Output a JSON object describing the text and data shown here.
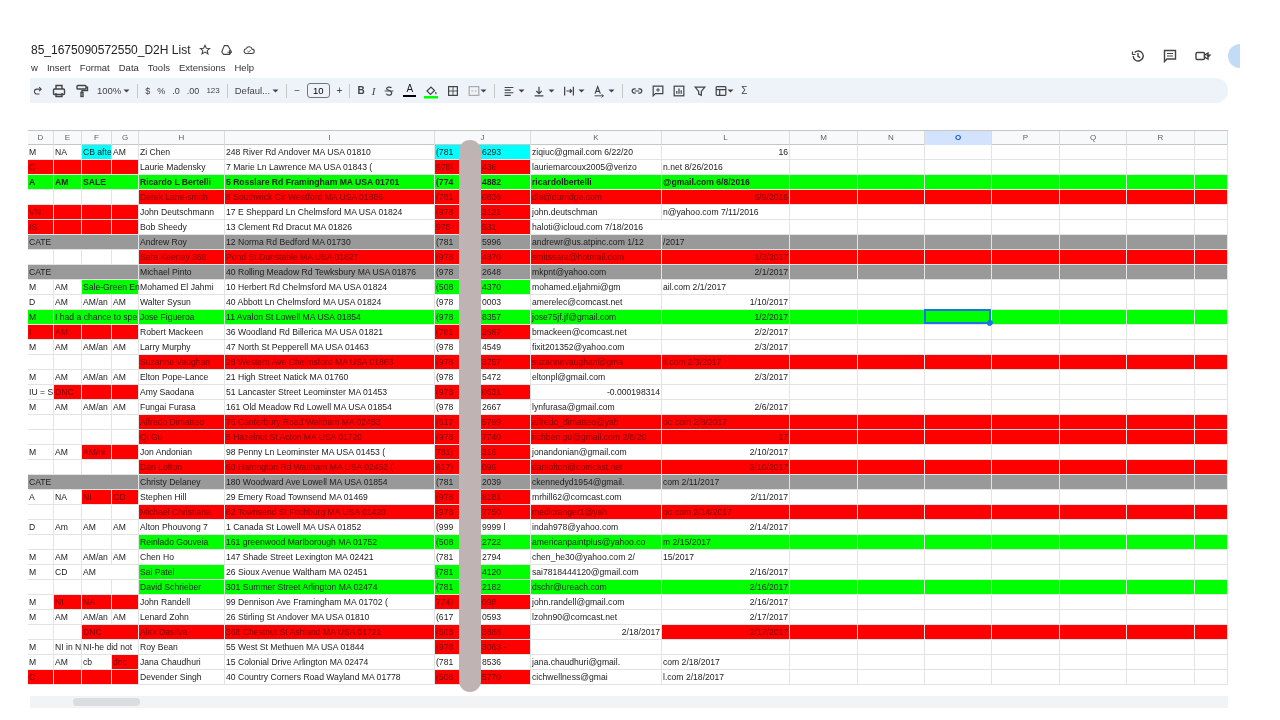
{
  "title": {
    "name": "85_1675090572550_D2H List"
  },
  "menu": [
    "w",
    "Insert",
    "Format",
    "Data",
    "Tools",
    "Extensions",
    "Help"
  ],
  "toolbar": {
    "zoom": "100%",
    "currency": "$",
    "percent": "%",
    "decrease_decimals": ".0",
    "increase_decimals": ".00",
    "number_format": "123",
    "font": "Defaul...",
    "minus": "−",
    "font_size": "10",
    "plus": "+",
    "bold": "B",
    "italic": "I",
    "text_color": "A",
    "functions": "Σ"
  },
  "sheet": {
    "columns": [
      {
        "label": "D",
        "selected": false
      },
      {
        "label": "E",
        "selected": false
      },
      {
        "label": "F",
        "selected": false
      },
      {
        "label": "G",
        "selected": false
      },
      {
        "label": "H",
        "selected": false
      },
      {
        "label": "I",
        "selected": false
      },
      {
        "label": "J",
        "selected": false
      },
      {
        "label": "K",
        "selected": false
      },
      {
        "label": "L",
        "selected": false
      },
      {
        "label": "M",
        "selected": false
      },
      {
        "label": "N",
        "selected": false
      },
      {
        "label": "O",
        "selected": true
      },
      {
        "label": "P",
        "selected": false
      },
      {
        "label": "Q",
        "selected": false
      },
      {
        "label": "R",
        "selected": false
      }
    ],
    "rows": [
      {
        "bold": false,
        "selected": false,
        "cells": [
          {
            "text": "M"
          },
          {
            "text": "NA"
          },
          {
            "text": "CB afte",
            "color": "#00ffff"
          },
          {
            "text": "AM"
          },
          {
            "text": "Zi Chen"
          },
          {
            "text": "248 River Rd Andover MA USA 01810"
          },
          {
            "parts": [
              "(781",
              "6293"
            ],
            "color": "#00ffff"
          },
          {
            "text": "ziqiuc@gmail.com 6/22/20"
          },
          {
            "text": "16",
            "kind": "number"
          }
        ]
      },
      {
        "bold": false,
        "selected": false,
        "cells": [
          {
            "text": "C",
            "color": "#ff0000"
          },
          {
            "color": "#ff0000"
          },
          {
            "color": "#ff0000"
          },
          {
            "color": "#ff0000"
          },
          {
            "text": "Laurie Madensky"
          },
          {
            "text": "7 Marie Ln Lawrence MA USA 01843 ("
          },
          {
            "parts": [
              "978)",
              "436"
            ],
            "color": "#ff0000"
          },
          {
            "text": "lauriemarcoux2005@verizo"
          },
          {
            "text": "n.net 8/26/2016"
          }
        ]
      },
      {
        "color": "#00ff00",
        "bold": true,
        "selected": false,
        "cells": [
          {
            "text": "A"
          },
          {
            "text": "AM"
          },
          {
            "text": "SALE"
          },
          {},
          {
            "text": "Ricardo L Bertelli"
          },
          {
            "text": "5 Rosslare Rd Framingham MA USA 01701"
          },
          {
            "parts": [
              "(774",
              "4882"
            ]
          },
          {
            "text": "ricardolbertelli"
          },
          {
            "text": "@gmail.com 6/8/2016"
          }
        ]
      },
      {
        "color": "#ff0000",
        "bold": false,
        "selected": false,
        "cells": [
          {
            "color": "#ffffff"
          },
          {
            "color": "#ffffff"
          },
          {
            "color": "#ffffff"
          },
          {
            "color": "#ffffff"
          },
          {
            "text": "Derek Lane-smith"
          },
          {
            "text": "8 Southwick Cir Westford MA USA 01886"
          },
          {
            "parts": [
              "(781",
              "0836"
            ]
          },
          {
            "text": "dls@durridge.com"
          },
          {
            "text": "6/9/2016",
            "kind": "number"
          }
        ]
      },
      {
        "bold": false,
        "selected": false,
        "cells": [
          {
            "text": "VN",
            "color": "#ff0000"
          },
          {
            "color": "#ff0000"
          },
          {
            "color": "#ff0000"
          },
          {
            "color": "#ff0000"
          },
          {
            "text": "John Deutschmann"
          },
          {
            "text": "17 E Sheppard Ln Chelmsford MA USA 01824"
          },
          {
            "parts": [
              "(978",
              "3121"
            ],
            "color": "#ff0000"
          },
          {
            "text": "john.deutschman"
          },
          {
            "text": "n@yahoo.com 7/11/2016"
          }
        ]
      },
      {
        "bold": false,
        "selected": false,
        "cells": [
          {
            "text": "IS",
            "color": "#ff0000"
          },
          {
            "color": "#ff0000"
          },
          {
            "color": "#ff0000"
          },
          {
            "color": "#ff0000"
          },
          {
            "text": "Bob Sheedy"
          },
          {
            "text": "13 Clement Rd Dracut MA 01826"
          },
          {
            "parts": [
              "978-",
              "531"
            ],
            "color": "#ff0000"
          },
          {
            "text": "haloti@icloud.com 7/18/2016"
          },
          {}
        ]
      },
      {
        "color": "#999999",
        "bold": false,
        "selected": false,
        "cells": [
          {
            "text": "CATE"
          },
          {},
          {},
          {},
          {
            "text": "Andrew Roy"
          },
          {
            "text": "12 Norma Rd Bedford MA 01730"
          },
          {
            "parts": [
              "(781",
              "5996"
            ]
          },
          {
            "text": "andrewr@us.atpinc.com 1/12"
          },
          {
            "text": "/2017"
          }
        ]
      },
      {
        "color": "#ff0000",
        "bold": false,
        "selected": false,
        "cells": [
          {
            "color": "#ffffff"
          },
          {
            "color": "#ffffff"
          },
          {
            "color": "#ffffff"
          },
          {
            "color": "#ffffff"
          },
          {
            "text": "Sara Keeney 368"
          },
          {
            "text": "Pond St Dunstable MA USA 01827"
          },
          {
            "parts": [
              "(978",
              "4870"
            ]
          },
          {
            "text": "smitssara@hotmail.com"
          },
          {
            "text": "1/3/2017",
            "kind": "number"
          }
        ]
      },
      {
        "color": "#999999",
        "bold": false,
        "selected": false,
        "cells": [
          {
            "text": "CATE"
          },
          {},
          {},
          {},
          {
            "text": "Michael Pinto"
          },
          {
            "text": "40 Rolling Meadow Rd Tewksbury MA USA 01876"
          },
          {
            "parts": [
              "(978",
              "2648"
            ]
          },
          {
            "text": "mkpnt@yahoo.com"
          },
          {
            "text": "2/1/2017",
            "kind": "number"
          }
        ]
      },
      {
        "bold": false,
        "selected": false,
        "cells": [
          {
            "text": "M"
          },
          {
            "text": "AM"
          },
          {
            "text": "Sale-Green En",
            "color": "#00ff00"
          },
          {},
          {
            "text": "Mohamed El Jahmi"
          },
          {
            "text": "10 Herbert Rd Chelmsford MA USA 01824"
          },
          {
            "parts": [
              "(508",
              "4370"
            ],
            "color": "#00ff00"
          },
          {
            "text": "mohamed.eljahmi@gm"
          },
          {
            "text": "ail.com 2/1/2017"
          }
        ]
      },
      {
        "bold": false,
        "selected": false,
        "cells": [
          {
            "text": "D"
          },
          {
            "text": "AM"
          },
          {
            "text": "AM/an"
          },
          {
            "text": "AM"
          },
          {
            "text": "Walter Sysun"
          },
          {
            "text": "40 Abbott Ln Chelmsford MA USA 01824"
          },
          {
            "parts": [
              "(978",
              "0003"
            ]
          },
          {
            "text": "amerelec@comcast.net"
          },
          {
            "text": "1/10/2017",
            "kind": "number"
          }
        ]
      },
      {
        "color": "#00ff00",
        "bold": false,
        "selected": true,
        "cells": [
          {
            "text": "M"
          },
          {
            "text": "I had a chance to spe"
          },
          {},
          {},
          {
            "text": "Jose Figueroa"
          },
          {
            "text": "11 Avalon St Lowell MA USA 01854"
          },
          {
            "parts": [
              "(978",
              "8357"
            ]
          },
          {
            "text": "jose75jf.jf@gmail.com"
          },
          {
            "text": "1/2/2017",
            "kind": "number"
          }
        ]
      },
      {
        "bold": false,
        "selected": false,
        "cells": [
          {
            "text": "I",
            "color": "#ff0000"
          },
          {
            "text": "AM",
            "color": "#ff0000"
          },
          {
            "color": "#ff0000"
          },
          {
            "color": "#ff0000"
          },
          {
            "text": "Robert Mackeen"
          },
          {
            "text": "36 Woodland Rd Billerica MA USA 01821"
          },
          {
            "parts": [
              "(781",
              "2687"
            ],
            "color": "#ff0000"
          },
          {
            "text": "bmackeen@comcast.net"
          },
          {
            "text": "2/2/2017",
            "kind": "number"
          }
        ]
      },
      {
        "bold": false,
        "selected": false,
        "cells": [
          {
            "text": "M"
          },
          {
            "text": "AM"
          },
          {
            "text": "AM/an"
          },
          {
            "text": "AM"
          },
          {
            "text": "Larry Murphy"
          },
          {
            "text": "47 North St Pepperell MA USA 01463"
          },
          {
            "parts": [
              "(978",
              "4549"
            ]
          },
          {
            "text": "fixit201352@yahoo.com"
          },
          {
            "text": "2/3/2017",
            "kind": "number"
          }
        ]
      },
      {
        "color": "#ff0000",
        "bold": false,
        "selected": false,
        "cells": [
          {
            "color": "#ffffff"
          },
          {
            "color": "#ffffff"
          },
          {
            "color": "#ffffff"
          },
          {
            "color": "#ffffff"
          },
          {
            "text": "Suzanne Vaughan"
          },
          {
            "text": "28 Western Ave Chelmsford MA USA 01863"
          },
          {
            "parts": [
              "(978",
              "3757"
            ]
          },
          {
            "text": "suzannevaughan@gma"
          },
          {
            "text": "il.com 2/3/2017"
          }
        ]
      },
      {
        "bold": false,
        "selected": false,
        "cells": [
          {
            "text": "M"
          },
          {
            "text": "AM"
          },
          {
            "text": "AM/an"
          },
          {
            "text": "AM"
          },
          {
            "text": "Elton Pope-Lance"
          },
          {
            "text": "21 High Street Natick MA 01760"
          },
          {
            "parts": [
              "(978",
              "5472"
            ]
          },
          {
            "text": "eltonpl@gmail.com"
          },
          {
            "text": "2/3/2017",
            "kind": "number"
          }
        ]
      },
      {
        "bold": false,
        "selected": false,
        "cells": [
          {
            "text": "IU = S"
          },
          {
            "text": "DNC",
            "color": "#ff0000"
          },
          {
            "color": "#ff0000"
          },
          {
            "color": "#ff0000"
          },
          {
            "text": "Amy Saodana"
          },
          {
            "text": "51 Lancaster Street Leominster MA 01453"
          },
          {
            "parts": [
              "(978",
              "0631"
            ],
            "color": "#ff0000"
          },
          {
            "text": "-0.000198314",
            "kind": "number"
          },
          {}
        ]
      },
      {
        "bold": false,
        "selected": false,
        "cells": [
          {
            "text": "M"
          },
          {
            "text": "AM"
          },
          {
            "text": "AM/an"
          },
          {
            "text": "AM"
          },
          {
            "text": "Fungai Furasa"
          },
          {
            "text": "161 Old Meadow Rd Lowell MA USA 01854"
          },
          {
            "parts": [
              "(978",
              "2667"
            ]
          },
          {
            "text": "lynfurasa@gmail.com"
          },
          {
            "text": "2/6/2017",
            "kind": "number"
          }
        ]
      },
      {
        "color": "#ff0000",
        "bold": false,
        "selected": false,
        "cells": [
          {
            "color": "#ffffff"
          },
          {
            "color": "#ffffff"
          },
          {
            "color": "#ffffff"
          },
          {
            "color": "#ffffff"
          },
          {
            "text": "Alfredo Dimatteo"
          },
          {
            "text": "76 Canterbury Road Waltham MA 02453"
          },
          {
            "parts": [
              "(617",
              "5799"
            ]
          },
          {
            "text": "alfredo_dimatteo@yah"
          },
          {
            "text": "oo.com 2/8/2017"
          }
        ]
      },
      {
        "color": "#ff0000",
        "bold": false,
        "selected": false,
        "cells": [
          {
            "color": "#ffffff"
          },
          {
            "color": "#ffffff"
          },
          {
            "color": "#ffffff"
          },
          {
            "color": "#ffffff"
          },
          {
            "text": "Qi Gu"
          },
          {
            "text": "5 Hazelnut St Acton MA USA 01720"
          },
          {
            "parts": [
              "(978",
              "7740"
            ]
          },
          {
            "text": "richben.gu@gmail.com 2/8/20"
          },
          {
            "text": "17",
            "kind": "number"
          }
        ]
      },
      {
        "bold": false,
        "selected": false,
        "cells": [
          {
            "text": "M"
          },
          {
            "text": "AM"
          },
          {
            "text": "AM/ni",
            "color": "#ff0000"
          },
          {
            "color": "#ff0000"
          },
          {
            "text": "Jon Andonian"
          },
          {
            "text": "98 Penny Ln Leominster MA USA 01453 ("
          },
          {
            "parts": [
              "781)",
              "316"
            ],
            "color": "#ff0000"
          },
          {
            "text": "jonandonian@gmail.com"
          },
          {
            "text": "2/10/2017",
            "kind": "number"
          }
        ]
      },
      {
        "color": "#ff0000",
        "bold": false,
        "selected": false,
        "cells": [
          {
            "color": "#ffffff"
          },
          {
            "color": "#ffffff"
          },
          {
            "color": "#ffffff"
          },
          {
            "color": "#ffffff"
          },
          {
            "text": "Dan Lofton"
          },
          {
            "text": "60 Harrington Rd Waltham MA USA 02452 ("
          },
          {
            "parts": [
              "617)",
              "099"
            ]
          },
          {
            "text": "danlofton@comcast.net"
          },
          {
            "text": "2/10/2017",
            "kind": "number"
          }
        ]
      },
      {
        "color": "#999999",
        "bold": false,
        "selected": false,
        "cells": [
          {
            "text": "CATE"
          },
          {},
          {},
          {},
          {
            "text": "Christy Delaney"
          },
          {
            "text": "180 Woodward Ave Lowell MA USA 01854"
          },
          {
            "parts": [
              "(781",
              "2039"
            ]
          },
          {
            "text": "ckennedyd1954@gmail."
          },
          {
            "text": "com 2/11/2017"
          }
        ]
      },
      {
        "bold": false,
        "selected": false,
        "cells": [
          {
            "text": "A"
          },
          {
            "text": "NA"
          },
          {
            "text": "NI",
            "color": "#ff0000"
          },
          {
            "text": "CD",
            "color": "#ff0000"
          },
          {
            "text": "Stephen Hill"
          },
          {
            "text": "29 Emery Road Townsend MA 01469"
          },
          {
            "parts": [
              "(978",
              "8181"
            ],
            "color": "#ff0000"
          },
          {
            "text": "mrhill62@comcast.com"
          },
          {
            "text": "2/11/2017",
            "kind": "number"
          }
        ]
      },
      {
        "color": "#ff0000",
        "bold": false,
        "selected": false,
        "cells": [
          {
            "color": "#ffffff"
          },
          {
            "color": "#ffffff"
          },
          {
            "color": "#ffffff"
          },
          {
            "color": "#ffffff"
          },
          {
            "text": "Michael Christiana"
          },
          {
            "text": "62 Townsend St Fitchburg MA USA 01420"
          },
          {
            "parts": [
              "(978",
              "7750"
            ]
          },
          {
            "text": "medicranger1@yah"
          },
          {
            "text": "oo.com 2/14/2017"
          }
        ]
      },
      {
        "bold": false,
        "selected": false,
        "cells": [
          {
            "text": "D"
          },
          {
            "text": "Am"
          },
          {
            "text": "AM"
          },
          {
            "text": "AM"
          },
          {
            "text": "Alton Phouvong 7"
          },
          {
            "text": "1 Canada St Lowell MA USA 01852"
          },
          {
            "parts": [
              "(999",
              "9999 l"
            ]
          },
          {
            "text": "indah978@yahoo.com"
          },
          {
            "text": "2/14/2017",
            "kind": "number"
          }
        ]
      },
      {
        "color": "#00ff00",
        "bold": false,
        "selected": false,
        "cells": [
          {
            "color": "#ffffff"
          },
          {
            "color": "#ffffff"
          },
          {
            "color": "#ffffff"
          },
          {
            "color": "#ffffff"
          },
          {
            "text": "Reinlado Gouveia"
          },
          {
            "text": "161 greenwood Marlborough MA 01752"
          },
          {
            "parts": [
              "(508",
              "2722"
            ]
          },
          {
            "text": "americanpaintplus@yahoo.co"
          },
          {
            "text": "m 2/15/2017"
          }
        ]
      },
      {
        "bold": false,
        "selected": false,
        "cells": [
          {
            "text": "M"
          },
          {
            "text": "AM"
          },
          {
            "text": "AM/an"
          },
          {
            "text": "AM"
          },
          {
            "text": "Chen Ho"
          },
          {
            "text": "147 Shade Street Lexington MA 02421"
          },
          {
            "parts": [
              "(781",
              "2794"
            ]
          },
          {
            "text": "chen_he30@yahoo.com 2/"
          },
          {
            "text": "15/2017"
          }
        ]
      },
      {
        "bold": false,
        "selected": false,
        "cells": [
          {
            "text": "M"
          },
          {
            "text": "CD"
          },
          {
            "text": "AM"
          },
          {},
          {
            "text": "Sai Patel",
            "color": "#00ff00"
          },
          {
            "text": "26 Sioux Avenue Waltham MA 02451"
          },
          {
            "parts": [
              "(781",
              "4120"
            ],
            "color": "#00ff00"
          },
          {
            "text": "sai7818444120@gmail.com"
          },
          {
            "text": "2/16/2017",
            "kind": "number"
          }
        ]
      },
      {
        "color": "#00ff00",
        "bold": false,
        "selected": false,
        "cells": [
          {
            "color": "#ffffff"
          },
          {
            "color": "#ffffff"
          },
          {
            "color": "#ffffff"
          },
          {
            "color": "#ffffff"
          },
          {
            "text": "David Schrieber"
          },
          {
            "text": "301 Summer Street Arlington MA 02474"
          },
          {
            "parts": [
              "(781",
              "2182"
            ]
          },
          {
            "text": "dschr@ureach.com"
          },
          {
            "text": "2/16/2017",
            "kind": "number"
          }
        ]
      },
      {
        "bold": false,
        "selected": false,
        "cells": [
          {
            "text": "M"
          },
          {
            "text": "NI",
            "color": "#ff0000"
          },
          {
            "text": "NA",
            "color": "#ff0000"
          },
          {
            "color": "#ff0000"
          },
          {
            "text": "John Randell"
          },
          {
            "text": "99 Dennison Ave Framingham MA 01702 ("
          },
          {
            "parts": [
              "774)",
              "098"
            ],
            "color": "#ff0000"
          },
          {
            "text": "john.randell@gmail.com"
          },
          {
            "text": "2/16/2017",
            "kind": "number"
          }
        ]
      },
      {
        "bold": false,
        "selected": false,
        "cells": [
          {
            "text": "M"
          },
          {
            "text": "AM"
          },
          {
            "text": "AM/an"
          },
          {
            "text": "AM"
          },
          {
            "text": "Lenard Zohn"
          },
          {
            "text": "26 Stirling St Andover MA USA 01810"
          },
          {
            "parts": [
              "(617",
              "0593"
            ]
          },
          {
            "text": "lzohn90@comcast.net"
          },
          {
            "text": "2/17/2017",
            "kind": "number"
          }
        ]
      },
      {
        "color": "#ff0000",
        "bold": false,
        "selected": false,
        "cells": [
          {
            "color": "#ffffff"
          },
          {
            "color": "#ffffff"
          },
          {
            "text": "DNC"
          },
          {},
          {
            "text": "Alex Dasilva"
          },
          {
            "text": "368 Chestnut St Ashland MA USA 01721"
          },
          {
            "parts": [
              "(508",
              "3888"
            ]
          },
          {
            "text": "2/18/2017",
            "kind": "number",
            "color": "#ffffff"
          },
          {
            "text": "2/17/2017",
            "kind": "number"
          }
        ]
      },
      {
        "bold": false,
        "selected": false,
        "cells": [
          {
            "text": "M"
          },
          {
            "text": "NI in N"
          },
          {
            "text": "NI-he did not"
          },
          {},
          {
            "text": "Roy Bean"
          },
          {
            "text": "55 West St Methuen MA USA 01844"
          },
          {
            "parts": [
              "(978",
              "3063 -"
            ],
            "color": "#ff0000"
          },
          {},
          {}
        ]
      },
      {
        "bold": false,
        "selected": false,
        "cells": [
          {
            "text": "M"
          },
          {
            "text": "AM"
          },
          {
            "text": "cb"
          },
          {
            "text": "dnc",
            "color": "#ff0000"
          },
          {
            "text": "Jana Chaudhuri"
          },
          {
            "text": "15 Colonial Drive Arlington MA 02474"
          },
          {
            "parts": [
              "(781",
              "8536"
            ]
          },
          {
            "text": "jana.chaudhuri@gmail."
          },
          {
            "text": "com 2/18/2017"
          }
        ]
      },
      {
        "bold": false,
        "selected": false,
        "cells": [
          {
            "text": "C",
            "color": "#ff0000"
          },
          {
            "color": "#ff0000"
          },
          {
            "color": "#ff0000"
          },
          {
            "color": "#ff0000"
          },
          {
            "text": "Devender Singh"
          },
          {
            "text": "40 Country Corners Road Wayland MA 01778"
          },
          {
            "parts": [
              "(508",
              "5770"
            ],
            "color": "#ff0000"
          },
          {
            "text": "cichwellness@gmai"
          },
          {
            "text": "l.com 2/18/2017"
          }
        ]
      }
    ]
  }
}
